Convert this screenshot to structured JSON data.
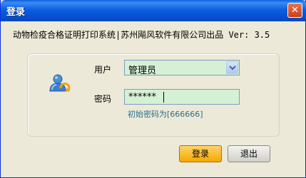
{
  "window": {
    "title": "登录",
    "close_glyph": "✕"
  },
  "header": {
    "subtitle": "动物检疫合格证明打印系统|苏州飚风软件有限公司出品 Ver: 3.5"
  },
  "form": {
    "user_label": "用户",
    "user_value": "管理员",
    "password_label": "密码",
    "password_value": "******",
    "password_hint": "初始密码为[666666]"
  },
  "buttons": {
    "login": "登录",
    "exit": "退出"
  },
  "icons": {
    "user": "user-icon",
    "dropdown": "chevron-down-icon",
    "close": "close-icon"
  },
  "colors": {
    "title_bar": "#0550d0",
    "field_background": "#d6f0d6",
    "login_button": "#f5a800",
    "hint_text": "#2b6f88"
  }
}
